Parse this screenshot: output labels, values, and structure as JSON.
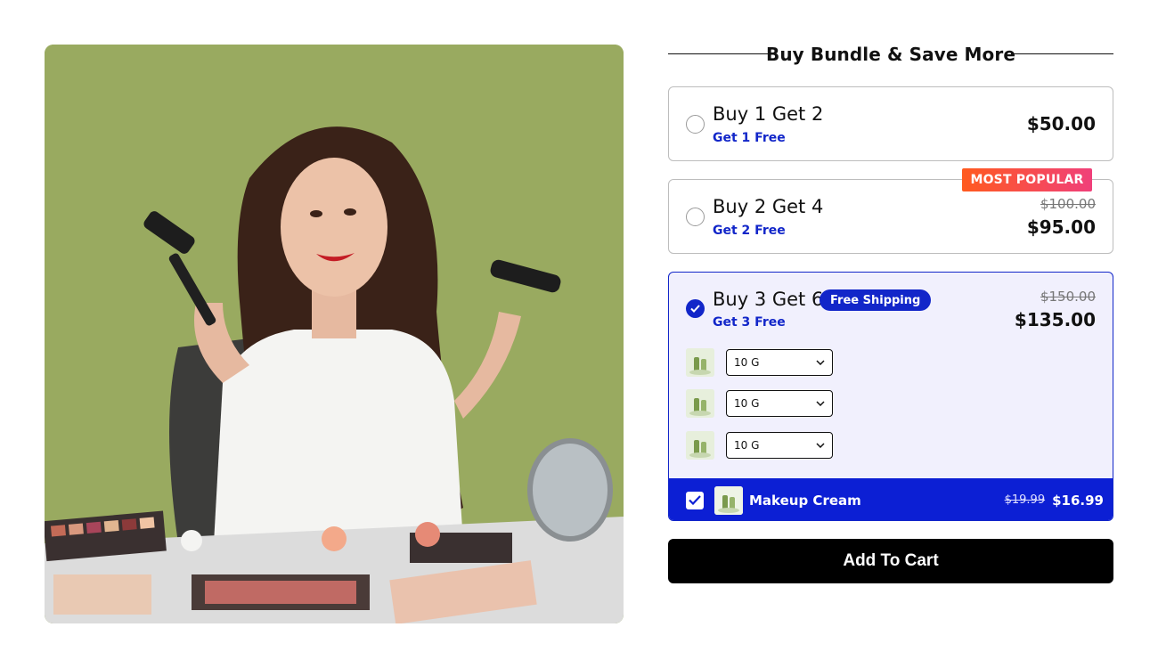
{
  "bundle": {
    "title": "Buy Bundle & Save More",
    "options": [
      {
        "title": "Buy 1 Get 2",
        "subtitle": "Get 1 Free",
        "price": "$50.00",
        "selected": false
      },
      {
        "title": "Buy 2 Get 4",
        "subtitle": "Get 2 Free",
        "old_price": "$100.00",
        "price": "$95.00",
        "badge": "MOST POPULAR",
        "selected": false
      },
      {
        "title": "Buy 3 Get 6",
        "subtitle": "Get 3 Free",
        "old_price": "$150.00",
        "price": "$135.00",
        "badge": "Free Shipping",
        "selected": true,
        "variants": [
          "10 G",
          "10 G",
          "10 G"
        ]
      }
    ]
  },
  "upsell": {
    "name": "Makeup Cream",
    "old_price": "$19.99",
    "price": "$16.99",
    "checked": true
  },
  "cart": {
    "label": "Add To Cart"
  },
  "icons": {
    "radio": "radio-icon",
    "check": "check-icon",
    "chevron": "chevron-down-icon"
  },
  "colors": {
    "accent": "#1226c9",
    "upsell_bg": "#0c1fd4",
    "popular_gradient_start": "#ff5a1f",
    "popular_gradient_end": "#f0407a",
    "cart_bg": "#000000"
  }
}
